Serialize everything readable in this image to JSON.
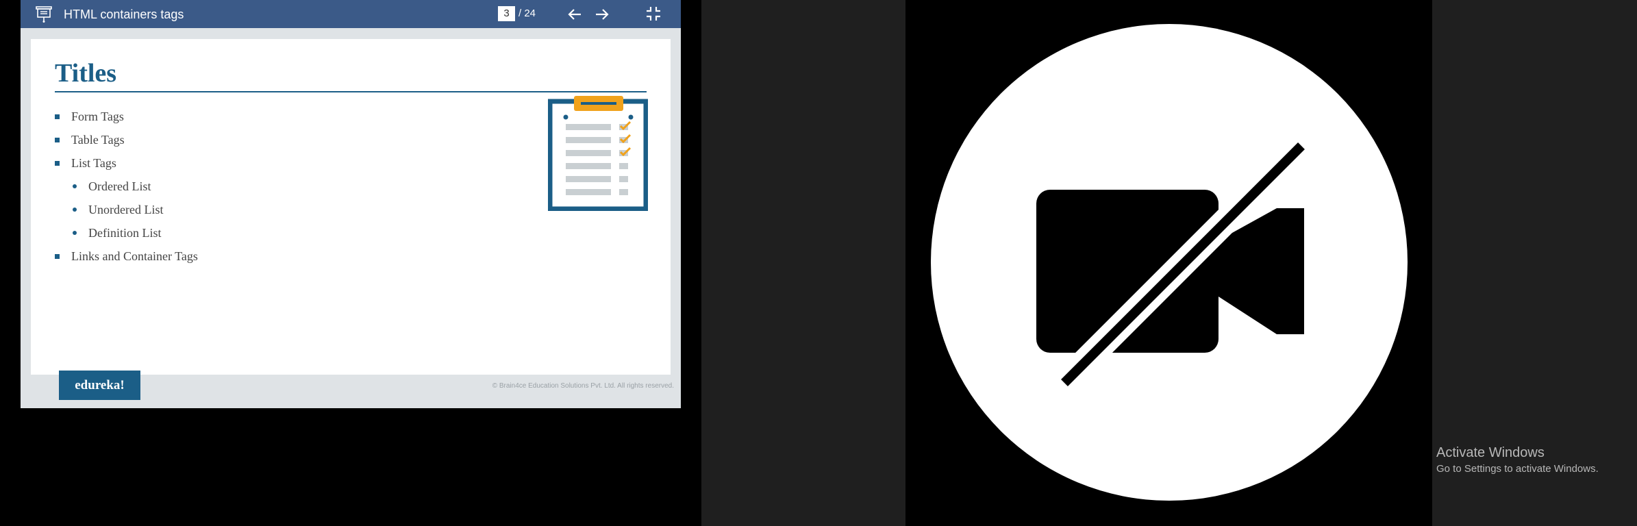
{
  "viewer": {
    "title": "HTML containers tags",
    "page_current": "3",
    "page_total": "/ 24"
  },
  "slide": {
    "title": "Titles",
    "bullets": [
      {
        "text": "Form Tags",
        "level": 1
      },
      {
        "text": "Table Tags",
        "level": 1
      },
      {
        "text": "List Tags",
        "level": 1
      },
      {
        "text": "Ordered List",
        "level": 2
      },
      {
        "text": "Unordered List",
        "level": 2
      },
      {
        "text": "Definition List",
        "level": 2
      },
      {
        "text": "Links and Container Tags",
        "level": 1
      }
    ],
    "logo": "edureka!",
    "copyright": "© Brain4ce Education Solutions Pvt. Ltd. All rights reserved."
  },
  "video": {
    "icon": "camera-off-icon"
  },
  "windows_notice": {
    "title": "Activate Windows",
    "subtitle": "Go to Settings to activate Windows."
  },
  "colors": {
    "toolbar": "#3b5a88",
    "brand_blue": "#1b5e87",
    "clipboard_orange": "#f0a21c"
  }
}
